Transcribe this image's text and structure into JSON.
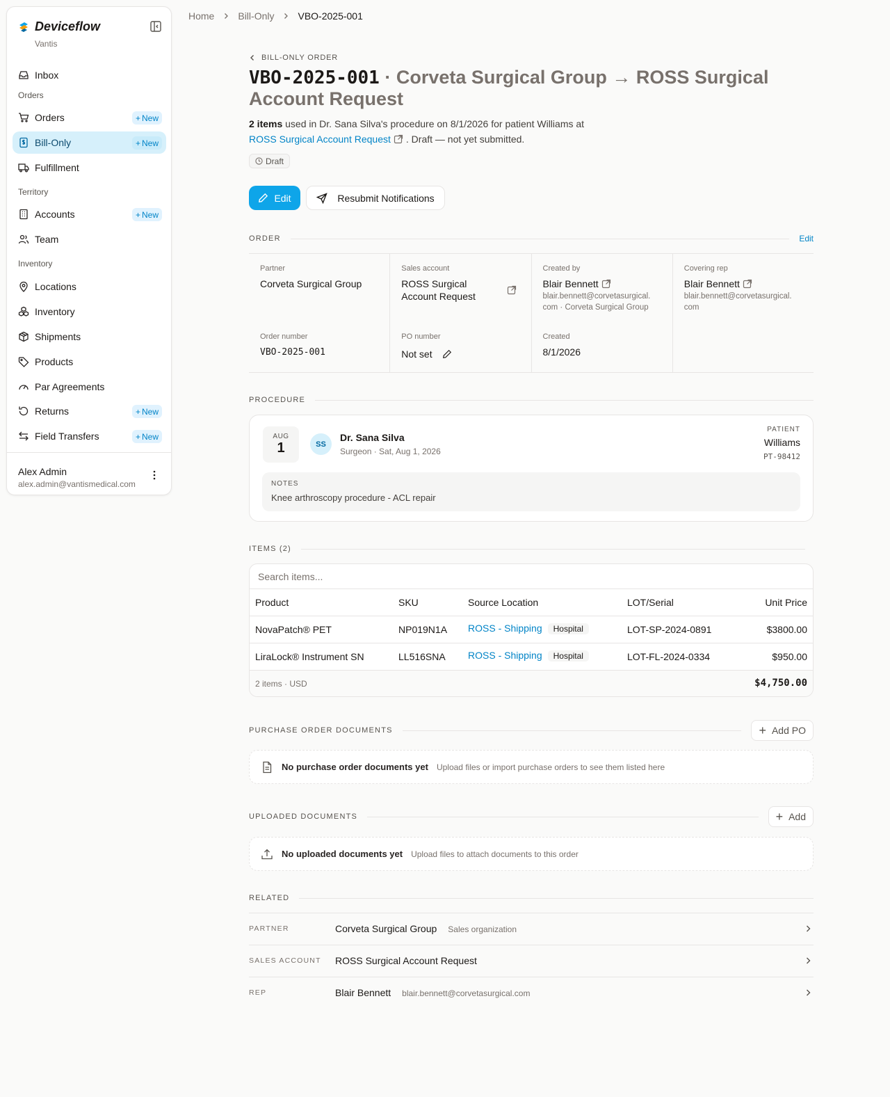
{
  "app": {
    "brand": "Deviceflow",
    "org": "Vantis",
    "accent": "#0ea5e9"
  },
  "sidebar": {
    "inbox": "Inbox",
    "sections": {
      "orders": "Orders",
      "territory": "Territory",
      "inventory": "Inventory"
    },
    "items": {
      "orders": "Orders",
      "bill_only": "Bill-Only",
      "fulfillment": "Fulfillment",
      "accounts": "Accounts",
      "team": "Team",
      "locations": "Locations",
      "inventory": "Inventory",
      "shipments": "Shipments",
      "products": "Products",
      "par_agreements": "Par Agreements",
      "returns": "Returns",
      "field_transfers": "Field Transfers"
    },
    "new_label": "New",
    "user": {
      "name": "Alex Admin",
      "email": "alex.admin@vantismedical.com"
    }
  },
  "breadcrumb": [
    "Home",
    "Bill-Only",
    "VBO-2025-001"
  ],
  "header": {
    "back_label": "BILL-ONLY ORDER",
    "code": "VBO-2025-001",
    "title_rest": " · Corveta Surgical Group → ROSS Surgical Account Request",
    "summary_count": "2 items",
    "summary_mid": " used in Dr. Sana Silva's procedure on 8/1/2026 for patient Williams at",
    "summary_link": "ROSS Surgical Account Request",
    "summary_end": ". Draft — not yet submitted.",
    "status": "Draft",
    "edit_button": "Edit",
    "resubmit_button": "Resubmit Notifications"
  },
  "order": {
    "section_label": "ORDER",
    "edit_link": "Edit",
    "partner_label": "Partner",
    "partner": "Corveta Surgical Group",
    "sales_account_label": "Sales account",
    "sales_account_line1": "ROSS Surgical",
    "sales_account_line2": "Account Request",
    "created_by_label": "Created by",
    "created_by": "Blair Bennett",
    "created_by_email_1": "blair.bennett@corvetasurgical.",
    "created_by_email_2": "com · Corveta Surgical Group",
    "covering_rep_label": "Covering rep",
    "covering_rep": "Blair Bennett",
    "covering_rep_email_1": "blair.bennett@corvetasurgical.",
    "covering_rep_email_2": "com",
    "order_number_label": "Order number",
    "order_number": "VBO-2025-001",
    "po_label": "PO number",
    "po_value": "Not set",
    "created_label": "Created",
    "created": "8/1/2026"
  },
  "procedure": {
    "section_label": "PROCEDURE",
    "month": "AUG",
    "day": "1",
    "initials": "SS",
    "surgeon": "Dr. Sana Silva",
    "surgeon_sub": "Surgeon · Sat, Aug 1, 2026",
    "patient_label": "PATIENT",
    "patient": "Williams",
    "patient_id": "PT-98412",
    "notes_label": "NOTES",
    "notes": "Knee arthroscopy procedure - ACL repair"
  },
  "items": {
    "section_label": "ITEMS (2)",
    "search_placeholder": "Search items...",
    "columns": [
      "Product",
      "SKU",
      "Source Location",
      "LOT/Serial",
      "Unit Price"
    ],
    "rows": [
      {
        "product": "NovaPatch® PET",
        "sku": "NP019N1A",
        "source": "ROSS - Shipping",
        "tag": "Hospital",
        "lot": "LOT-SP-2024-0891",
        "price": "$3800.00"
      },
      {
        "product": "LiraLock® Instrument SN",
        "sku": "LL516SNA",
        "source": "ROSS - Shipping",
        "tag": "Hospital",
        "lot": "LOT-FL-2024-0334",
        "price": "$950.00"
      }
    ],
    "footer_count": "2 items · USD",
    "total": "$4,750.00"
  },
  "po_docs": {
    "section_label": "PURCHASE ORDER DOCUMENTS",
    "add_button": "Add PO",
    "empty_title": "No purchase order documents yet",
    "empty_sub": "Upload files or import purchase orders to see them listed here"
  },
  "uploaded_docs": {
    "section_label": "UPLOADED DOCUMENTS",
    "add_button": "Add",
    "empty_title": "No uploaded documents yet",
    "empty_sub": "Upload files to attach documents to this order"
  },
  "related": {
    "section_label": "RELATED",
    "rows": [
      {
        "label": "PARTNER",
        "value": "Corveta Surgical Group",
        "sub": "Sales organization"
      },
      {
        "label": "SALES ACCOUNT",
        "value": "ROSS Surgical Account Request",
        "sub": ""
      },
      {
        "label": "REP",
        "value": "Blair Bennett",
        "sub": "blair.bennett@corvetasurgical.com"
      }
    ]
  }
}
